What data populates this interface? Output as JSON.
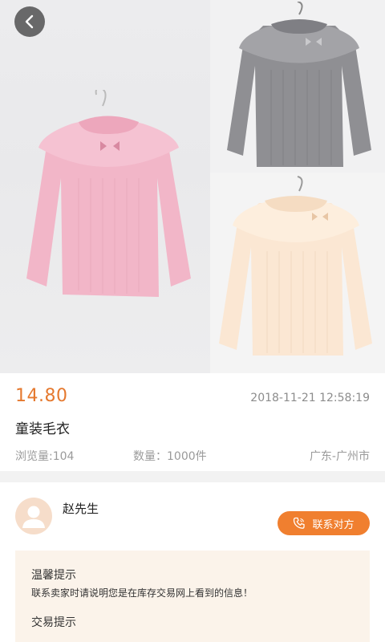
{
  "product": {
    "price": "14.80",
    "posted_at": "2018-11-21 12:58:19",
    "title": "童装毛衣",
    "views": "浏览量:104",
    "quantity": "数量：1000件",
    "location": "广东-广州市",
    "images": [
      "pink-sweater",
      "grey-sweater",
      "cream-sweater"
    ]
  },
  "seller": {
    "name": "赵先生",
    "contact_label": "联系对方"
  },
  "tips": {
    "heading": "温馨提示",
    "body": "联系卖家时请说明您是在库存交易网上看到的信息！",
    "trade_heading": "交易提示"
  },
  "colors": {
    "accent": "#f07f2f",
    "price": "#e5792f",
    "tips_bg": "#fbf3ea"
  },
  "icons": {
    "back": "chevron-left-icon",
    "phone": "phone-icon",
    "avatar": "user-icon"
  }
}
